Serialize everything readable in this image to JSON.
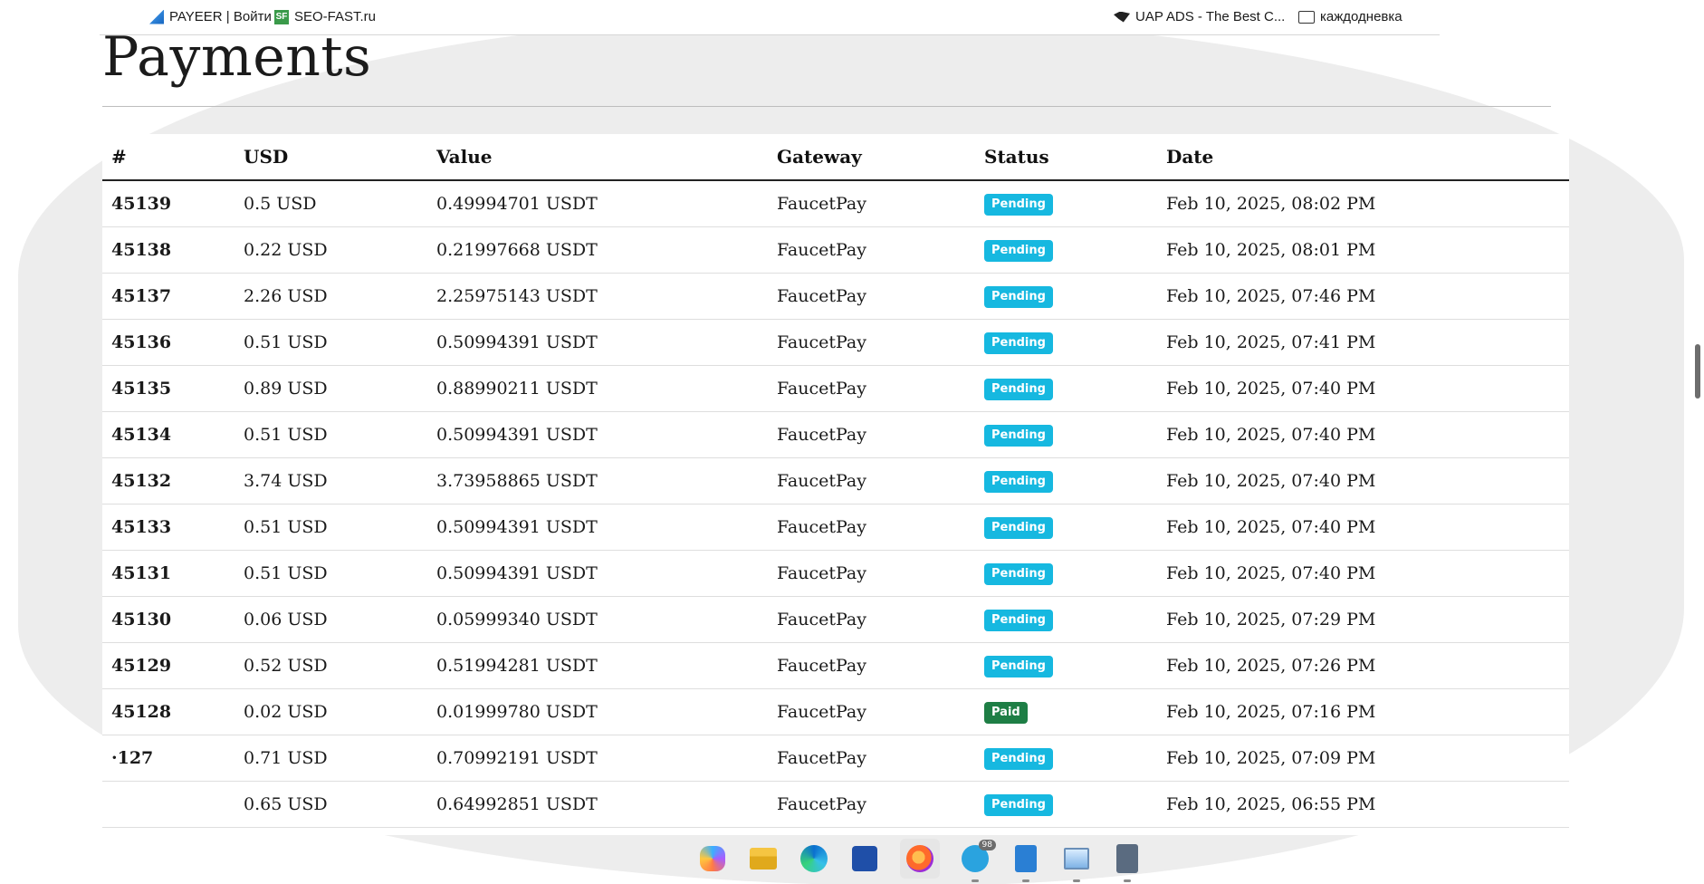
{
  "bookmarks": [
    {
      "label": "PAYEER | Войти",
      "icon": "payeer-icon"
    },
    {
      "label": "SEO-FAST.ru",
      "icon": "seo-fast-icon",
      "icon_text": "SF"
    },
    {
      "label": "UAP ADS - The Best C...",
      "icon": "uap-ads-icon"
    },
    {
      "label": "каждодневка",
      "icon": "folder-icon"
    }
  ],
  "page": {
    "title": "Payments"
  },
  "table": {
    "headers": [
      "#",
      "USD",
      "Value",
      "Gateway",
      "Status",
      "Date"
    ],
    "rows": [
      {
        "id": "45139",
        "usd": "0.5 USD",
        "value": "0.49994701 USDT",
        "gateway": "FaucetPay",
        "status": "Pending",
        "date": "Feb 10, 2025, 08:02 PM"
      },
      {
        "id": "45138",
        "usd": "0.22 USD",
        "value": "0.21997668 USDT",
        "gateway": "FaucetPay",
        "status": "Pending",
        "date": "Feb 10, 2025, 08:01 PM"
      },
      {
        "id": "45137",
        "usd": "2.26 USD",
        "value": "2.25975143 USDT",
        "gateway": "FaucetPay",
        "status": "Pending",
        "date": "Feb 10, 2025, 07:46 PM"
      },
      {
        "id": "45136",
        "usd": "0.51 USD",
        "value": "0.50994391 USDT",
        "gateway": "FaucetPay",
        "status": "Pending",
        "date": "Feb 10, 2025, 07:41 PM"
      },
      {
        "id": "45135",
        "usd": "0.89 USD",
        "value": "0.88990211 USDT",
        "gateway": "FaucetPay",
        "status": "Pending",
        "date": "Feb 10, 2025, 07:40 PM"
      },
      {
        "id": "45134",
        "usd": "0.51 USD",
        "value": "0.50994391 USDT",
        "gateway": "FaucetPay",
        "status": "Pending",
        "date": "Feb 10, 2025, 07:40 PM"
      },
      {
        "id": "45132",
        "usd": "3.74 USD",
        "value": "3.73958865 USDT",
        "gateway": "FaucetPay",
        "status": "Pending",
        "date": "Feb 10, 2025, 07:40 PM"
      },
      {
        "id": "45133",
        "usd": "0.51 USD",
        "value": "0.50994391 USDT",
        "gateway": "FaucetPay",
        "status": "Pending",
        "date": "Feb 10, 2025, 07:40 PM"
      },
      {
        "id": "45131",
        "usd": "0.51 USD",
        "value": "0.50994391 USDT",
        "gateway": "FaucetPay",
        "status": "Pending",
        "date": "Feb 10, 2025, 07:40 PM"
      },
      {
        "id": "45130",
        "usd": "0.06 USD",
        "value": "0.05999340 USDT",
        "gateway": "FaucetPay",
        "status": "Pending",
        "date": "Feb 10, 2025, 07:29 PM"
      },
      {
        "id": "45129",
        "usd": "0.52 USD",
        "value": "0.51994281 USDT",
        "gateway": "FaucetPay",
        "status": "Pending",
        "date": "Feb 10, 2025, 07:26 PM"
      },
      {
        "id": "45128",
        "usd": "0.02 USD",
        "value": "0.01999780 USDT",
        "gateway": "FaucetPay",
        "status": "Paid",
        "date": "Feb 10, 2025, 07:16 PM"
      },
      {
        "id": "·127",
        "usd": "0.71 USD",
        "value": "0.70992191 USDT",
        "gateway": "FaucetPay",
        "status": "Pending",
        "date": "Feb 10, 2025, 07:09 PM"
      },
      {
        "id": "",
        "usd": "0.65 USD",
        "value": "0.64992851 USDT",
        "gateway": "FaucetPay",
        "status": "Pending",
        "date": "Feb 10, 2025, 06:55 PM"
      }
    ]
  },
  "status_colors": {
    "Pending": "#16b8e0",
    "Paid": "#1e7e45"
  },
  "taskbar": {
    "apps": [
      {
        "name": "copilot-icon"
      },
      {
        "name": "file-explorer-icon"
      },
      {
        "name": "edge-browser-icon"
      },
      {
        "name": "microsoft-store-icon"
      },
      {
        "name": "firefox-icon",
        "active": true
      },
      {
        "name": "telegram-icon",
        "badge": "98"
      },
      {
        "name": "notepad-icon"
      },
      {
        "name": "resource-monitor-icon"
      },
      {
        "name": "calculator-icon"
      }
    ]
  }
}
